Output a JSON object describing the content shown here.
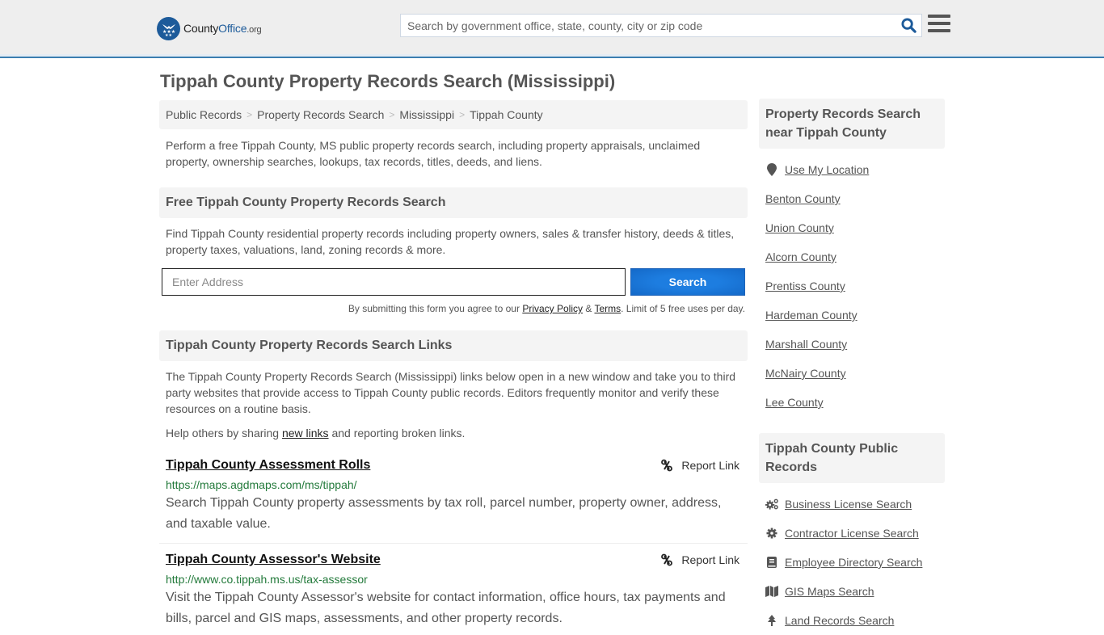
{
  "header": {
    "logo": {
      "county": "County",
      "office": "Office",
      "org": ".org"
    },
    "search_placeholder": "Search by government office, state, county, city or zip code",
    "brand_color": "#1d5b9a",
    "accent_border": "#3b7eb0"
  },
  "page_title": "Tippah County Property Records Search (Mississippi)",
  "breadcrumb": [
    "Public Records",
    "Property Records Search",
    "Mississippi",
    "Tippah County"
  ],
  "intro": "Perform a free Tippah County, MS public property records search, including property appraisals, unclaimed property, ownership searches, lookups, tax records, titles, deeds, and liens.",
  "free_search": {
    "heading": "Free Tippah County Property Records Search",
    "description": "Find Tippah County residential property records including property owners, sales & transfer history, deeds & titles, property taxes, valuations, land, zoning records & more.",
    "address_placeholder": "Enter Address",
    "button_label": "Search",
    "terms_prefix": "By submitting this form you agree to our ",
    "privacy_label": "Privacy Policy",
    "terms_amp": " & ",
    "terms_label": "Terms",
    "terms_suffix": ". Limit of 5 free uses per day."
  },
  "links_section": {
    "heading": "Tippah County Property Records Search Links",
    "description": "The Tippah County Property Records Search (Mississippi) links below open in a new window and take you to third party websites that provide access to Tippah County public records. Editors frequently monitor and verify these resources on a routine basis.",
    "help_prefix": "Help others by sharing ",
    "help_link": "new links",
    "help_suffix": " and reporting broken links.",
    "items": [
      {
        "title": "Tippah County Assessment Rolls",
        "url": "https://maps.agdmaps.com/ms/tippah/",
        "description": "Search Tippah County property assessments by tax roll, parcel number, property owner, address, and taxable value.",
        "report_label": "Report Link"
      },
      {
        "title": "Tippah County Assessor's Website",
        "url": "http://www.co.tippah.ms.us/tax-assessor",
        "description": "Visit the Tippah County Assessor's website for contact information, office hours, tax payments and bills, parcel and GIS maps, assessments, and other property records.",
        "report_label": "Report Link"
      }
    ]
  },
  "sidebar": {
    "near_heading": "Property Records Search near Tippah County",
    "use_location": "Use My Location",
    "near_counties": [
      "Benton County",
      "Union County",
      "Alcorn County",
      "Prentiss County",
      "Hardeman County",
      "Marshall County",
      "McNairy County",
      "Lee County"
    ],
    "public_heading": "Tippah County Public Records",
    "public_records": [
      {
        "label": "Business License Search",
        "icon": "gears-icon"
      },
      {
        "label": "Contractor License Search",
        "icon": "gear-icon"
      },
      {
        "label": "Employee Directory Search",
        "icon": "book-icon"
      },
      {
        "label": "GIS Maps Search",
        "icon": "map-icon"
      },
      {
        "label": "Land Records Search",
        "icon": "tree-icon"
      }
    ]
  }
}
